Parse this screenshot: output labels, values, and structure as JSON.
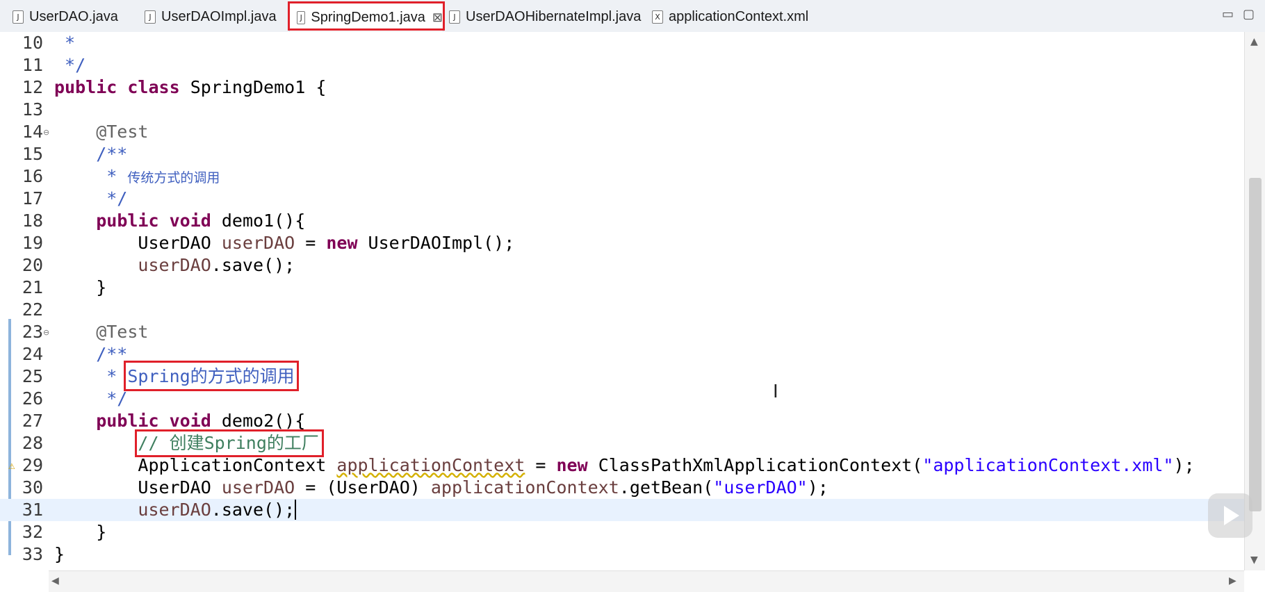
{
  "tabs": [
    {
      "label": "UserDAO.java",
      "icon": "J"
    },
    {
      "label": "UserDAOImpl.java",
      "icon": "J"
    },
    {
      "label": "SpringDemo1.java",
      "icon": "J",
      "active": true,
      "close": "⊠"
    },
    {
      "label": "UserDAOHibernateImpl.java",
      "icon": "J"
    },
    {
      "label": "applicationContext.xml",
      "icon": "X"
    }
  ],
  "window_controls": {
    "minimize": "▭",
    "restore": "▢"
  },
  "editor": {
    "line_numbers": [
      "10",
      "11",
      "12",
      "13",
      "14",
      "15",
      "16",
      "17",
      "18",
      "19",
      "20",
      "21",
      "22",
      "23",
      "24",
      "25",
      "26",
      "27",
      "28",
      "29",
      "30",
      "31",
      "32",
      "33"
    ],
    "code": {
      "l10": " *",
      "l11": " */",
      "l12_kw1": "public",
      "l12_kw2": "class",
      "l12_rest": "SpringDemo1 {",
      "l14": "    @Test",
      "l15": "    /**",
      "l16_star": "     * ",
      "l16_text": "传统方式的调用",
      "l17": "     */",
      "l18_kw1": "public",
      "l18_kw2": "void",
      "l18_rest": "demo1(){",
      "l19_a": "        UserDAO ",
      "l19_var": "userDAO",
      "l19_b": " = ",
      "l19_kw": "new",
      "l19_c": " UserDAOImpl();",
      "l20_var": "userDAO",
      "l20_b": ".save();",
      "l21": "    }",
      "l23": "    @Test",
      "l24": "    /**",
      "l25_star": "     * ",
      "l25_text": "Spring的方式的调用",
      "l26": "     */",
      "l27_kw1": "public",
      "l27_kw2": "void",
      "l27_rest": "demo2(){",
      "l28": "// 创建Spring的工厂",
      "l29_a": "        ApplicationContext ",
      "l29_var": "applicationContext",
      "l29_b": " = ",
      "l29_kw": "new",
      "l29_c": " ClassPathXmlApplicationContext(",
      "l29_str": "\"applicationContext.xml\"",
      "l29_d": ");",
      "l30_a": "        UserDAO ",
      "l30_var1": "userDAO",
      "l30_b": " = (UserDAO) ",
      "l30_var2": "applicationContext",
      "l30_c": ".getBean(",
      "l30_str": "\"userDAO\"",
      "l30_d": ");",
      "l31_var": "userDAO",
      "l31_b": ".save();",
      "l32": "    }",
      "l33": "}"
    }
  },
  "fold_icon": "⊖",
  "warning_icon": "⚠",
  "ibeam_cursor": "I",
  "scroll_arrows": {
    "up": "▲",
    "down": "▼",
    "left": "◀",
    "right": "▶"
  },
  "colors": {
    "highlight_box": "#e0202a",
    "keyword": "#7f0055",
    "javadoc": "#3f5fbf",
    "line_comment": "#3f7f5f",
    "string": "#2a00ff"
  }
}
